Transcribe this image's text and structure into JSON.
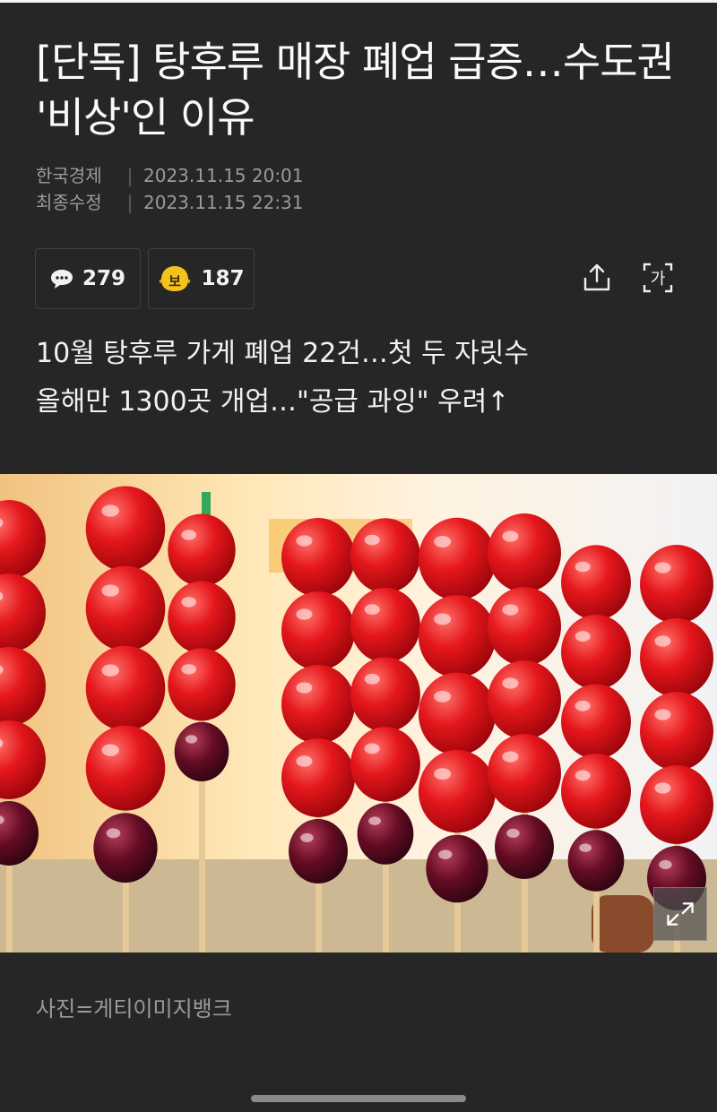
{
  "article": {
    "title": "[단독] 탕후루 매장 폐업 급증…수도권 '비상'인 이유",
    "source": "한국경제",
    "published_date": "2023.11.15 20:01",
    "modified_label": "최종수정",
    "modified_date": "2023.11.15 22:31",
    "subtitle_line1": "10월 탕후루 가게 폐업 22건…첫 두 자릿수",
    "subtitle_line2": "올해만 1300곳 개업…\"공급 과잉\" 우려↑"
  },
  "stats": {
    "comment_count": "279",
    "reaction_count": "187",
    "reaction_icon_text": "보"
  },
  "toolbar": {
    "separator": "|",
    "share_icon": "share-icon",
    "font_size_icon": "font-size-icon",
    "font_size_icon_text": "가"
  },
  "photo": {
    "caption": "사진=게티이미지뱅크",
    "expand_icon": "expand-icon"
  },
  "colors": {
    "background": "#262626",
    "meta_text": "#9a9a9a",
    "border": "#414141",
    "reaction_yellow": "#f4c21f"
  }
}
